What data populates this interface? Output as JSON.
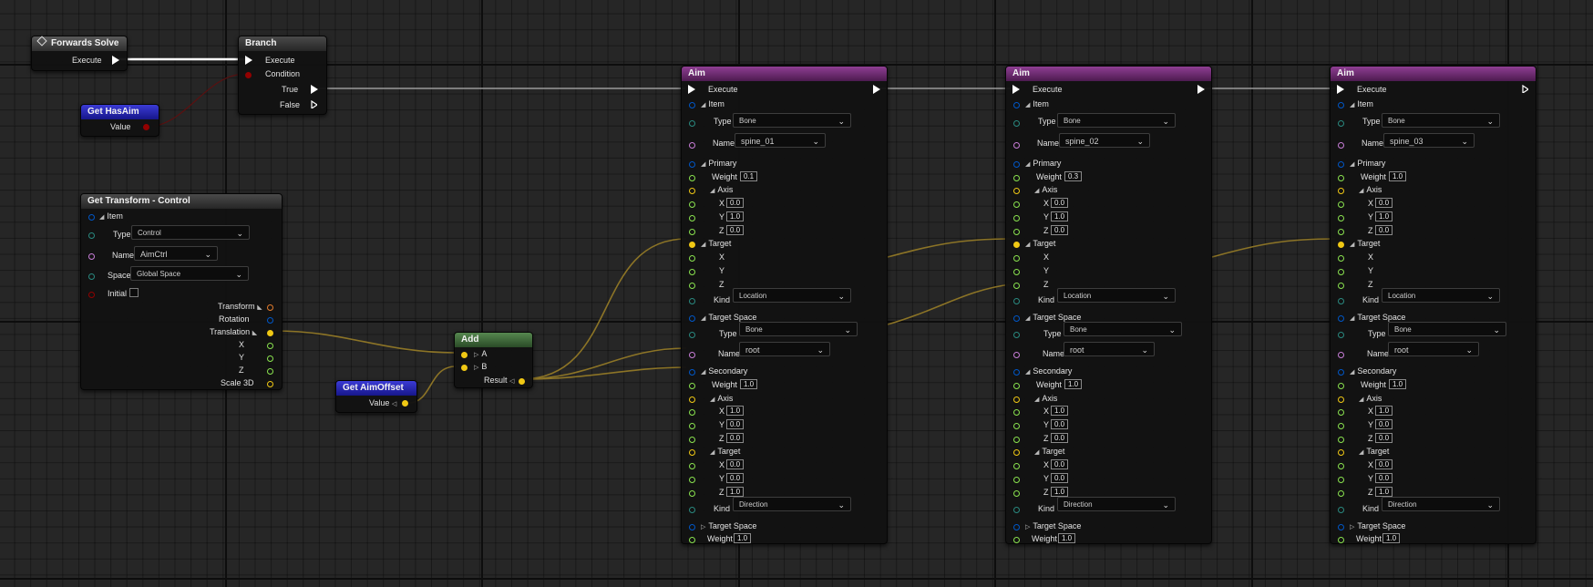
{
  "colors": {
    "exec": "#ffffff",
    "bool": "#920101",
    "struct": "#0057c8",
    "transform": "#e47d2d",
    "vector": "#f0c814",
    "float": "#8ae34f",
    "enum": "#2a8a80",
    "name": "#c97ed9",
    "wire_vector": "#8c7426"
  },
  "forwards_solve": {
    "title": "Forwards Solve",
    "execute": "Execute"
  },
  "branch": {
    "title": "Branch",
    "execute": "Execute",
    "condition": "Condition",
    "true": "True",
    "false": "False"
  },
  "get_has_aim": {
    "title": "Get HasAim",
    "value": "Value"
  },
  "get_transform": {
    "title": "Get Transform - Control",
    "item": "Item",
    "type_label": "Type",
    "type_value": "Control",
    "name_label": "Name",
    "name_value": "AimCtrl",
    "space_label": "Space",
    "space_value": "Global Space",
    "initial": "Initial",
    "transform": "Transform",
    "rotation": "Rotation",
    "translation": "Translation",
    "x": "X",
    "y": "Y",
    "z": "Z",
    "scale": "Scale 3D"
  },
  "get_aim_offset": {
    "title": "Get AimOffset",
    "value": "Value"
  },
  "add": {
    "title": "Add",
    "a": "A",
    "b": "B",
    "result": "Result"
  },
  "aim_labels": {
    "title": "Aim",
    "execute": "Execute",
    "item": "Item",
    "type": "Type",
    "name": "Name",
    "primary": "Primary",
    "weight": "Weight",
    "axis": "Axis",
    "x": "X",
    "y": "Y",
    "z": "Z",
    "target": "Target",
    "kind": "Kind",
    "target_space": "Target Space",
    "secondary": "Secondary"
  },
  "aims": [
    {
      "type": "Bone",
      "name": "spine_01",
      "primary_weight": "0.1",
      "axis": [
        "0.0",
        "1.0",
        "0.0"
      ],
      "kind": "Location",
      "ts_type": "Bone",
      "ts_name": "root",
      "sec_weight": "1.0",
      "sec_axis": [
        "1.0",
        "0.0",
        "0.0"
      ],
      "sec_target": [
        "0.0",
        "0.0",
        "1.0"
      ],
      "sec_kind": "Direction",
      "weight": "1.0"
    },
    {
      "type": "Bone",
      "name": "spine_02",
      "primary_weight": "0.3",
      "axis": [
        "0.0",
        "1.0",
        "0.0"
      ],
      "kind": "Location",
      "ts_type": "Bone",
      "ts_name": "root",
      "sec_weight": "1.0",
      "sec_axis": [
        "1.0",
        "0.0",
        "0.0"
      ],
      "sec_target": [
        "0.0",
        "0.0",
        "1.0"
      ],
      "sec_kind": "Direction",
      "weight": "1.0"
    },
    {
      "type": "Bone",
      "name": "spine_03",
      "primary_weight": "1.0",
      "axis": [
        "0.0",
        "1.0",
        "0.0"
      ],
      "kind": "Location",
      "ts_type": "Bone",
      "ts_name": "root",
      "sec_weight": "1.0",
      "sec_axis": [
        "1.0",
        "0.0",
        "0.0"
      ],
      "sec_target": [
        "0.0",
        "0.0",
        "1.0"
      ],
      "sec_kind": "Direction",
      "weight": "1.0"
    }
  ]
}
